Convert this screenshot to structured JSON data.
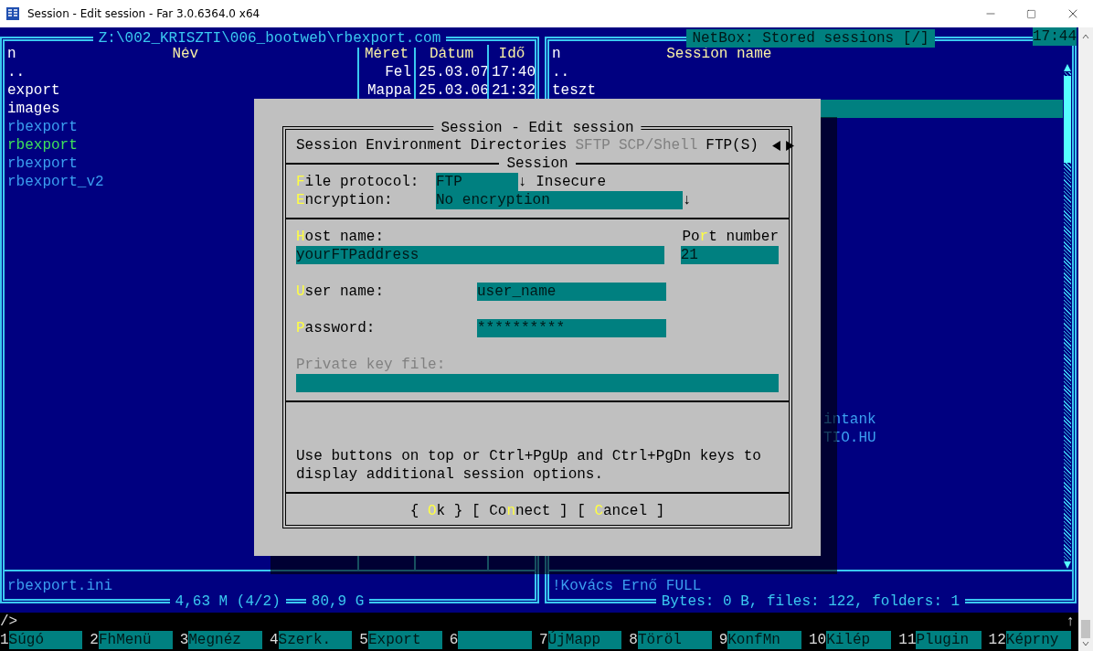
{
  "window": {
    "title": "Session - Edit session - Far 3.0.6364.0 x64"
  },
  "clock": "17:44",
  "left_panel": {
    "title": "Z:\\002_KRISZTI\\006_bootweb\\rbexport.com",
    "active": false,
    "columns": [
      "n",
      "Név",
      "Méret",
      "Dátum",
      "Idő"
    ],
    "files": [
      {
        "name": "..",
        "size": "Fel",
        "date": "25.03.07",
        "time": "17:40",
        "color": "#ffffff"
      },
      {
        "name": "export",
        "size": "Mappa",
        "date": "25.03.06",
        "time": "21:32",
        "color": "#ffffff"
      },
      {
        "name": "images",
        "color": "#ffffff"
      },
      {
        "name": "rbexport",
        "color": "#3b9ff0"
      },
      {
        "name": "rbexport",
        "color": "#3ee05a"
      },
      {
        "name": "rbexport",
        "color": "#3b9ff0"
      },
      {
        "name": "rbexport_v2",
        "color": "#3b9ff0"
      }
    ],
    "info": "rbexport.ini",
    "stats": [
      "4,63 M (4/2)",
      "80,9 G"
    ]
  },
  "right_panel": {
    "title": "NetBox: Stored sessions [/]",
    "active": true,
    "columns": [
      "n",
      "Session name"
    ],
    "items": [
      {
        "name": "..",
        "selected": false,
        "clipped": false,
        "color": "#ffffff"
      },
      {
        "name": "teszt",
        "selected": false,
        "clipped": false,
        "color": "#ffffff"
      },
      {
        "selected": true,
        "clipped": false
      },
      {
        "name": "intank",
        "selected": false,
        "clipped": true,
        "color": "#3b9ff0"
      },
      {
        "name": "TIO.HU",
        "selected": false,
        "clipped": true,
        "color": "#3b9ff0"
      }
    ],
    "info": "!Kovács Ernő FULL",
    "stats": [
      "Bytes: 0 B, files: 122, folders: 1"
    ]
  },
  "dialog": {
    "title": "Session - Edit session",
    "tabs": [
      {
        "label": "Session",
        "disabled": false
      },
      {
        "label": "Environment",
        "disabled": false
      },
      {
        "label": "Directories",
        "disabled": false
      },
      {
        "label": "SFTP",
        "disabled": true
      },
      {
        "label": "SCP/Shell",
        "disabled": true
      },
      {
        "label": "FTP(S)",
        "disabled": false
      }
    ],
    "section": "Session",
    "protocol": {
      "label": "**F**ile protocol:",
      "value": "FTP",
      "note": "↓ Insecure"
    },
    "encryption": {
      "label": "**E**ncryption:",
      "value": "No encryption",
      "arrow": "↓"
    },
    "host": {
      "label": "**H**ost name:",
      "value": "yourFTPaddress"
    },
    "port": {
      "label": "Po**r**t number",
      "value": "21"
    },
    "user": {
      "label": "**U**ser name:",
      "value": "user_name"
    },
    "password": {
      "label": "**P**assword:",
      "value": "**********"
    },
    "private_key": {
      "label": "Private key file:",
      "disabled": true
    },
    "hint": "Use buttons on top or Ctrl+PgUp and Ctrl+PgDn keys to display additional session options.",
    "buttons": [
      "{ **O**k }",
      "[ Co**n**nect ]",
      "[ **C**ancel ]"
    ]
  },
  "command_line": {
    "prompt": "/>",
    "mark": "↑"
  },
  "keybar": [
    {
      "key": "1",
      "label": "Súgó"
    },
    {
      "key": "2",
      "label": "FhMenü"
    },
    {
      "key": "3",
      "label": "Megnéz"
    },
    {
      "key": "4",
      "label": "Szerk."
    },
    {
      "key": "5",
      "label": "Export"
    },
    {
      "key": "6"
    },
    {
      "key": "7",
      "label": "ÚjMapp"
    },
    {
      "key": "8",
      "label": "Töröl"
    },
    {
      "key": "9",
      "label": "KonfMn"
    },
    {
      "key": "10",
      "label": "Kilép"
    },
    {
      "key": "11",
      "label": "Plugin"
    },
    {
      "key": "12",
      "label": "Képrny"
    }
  ]
}
